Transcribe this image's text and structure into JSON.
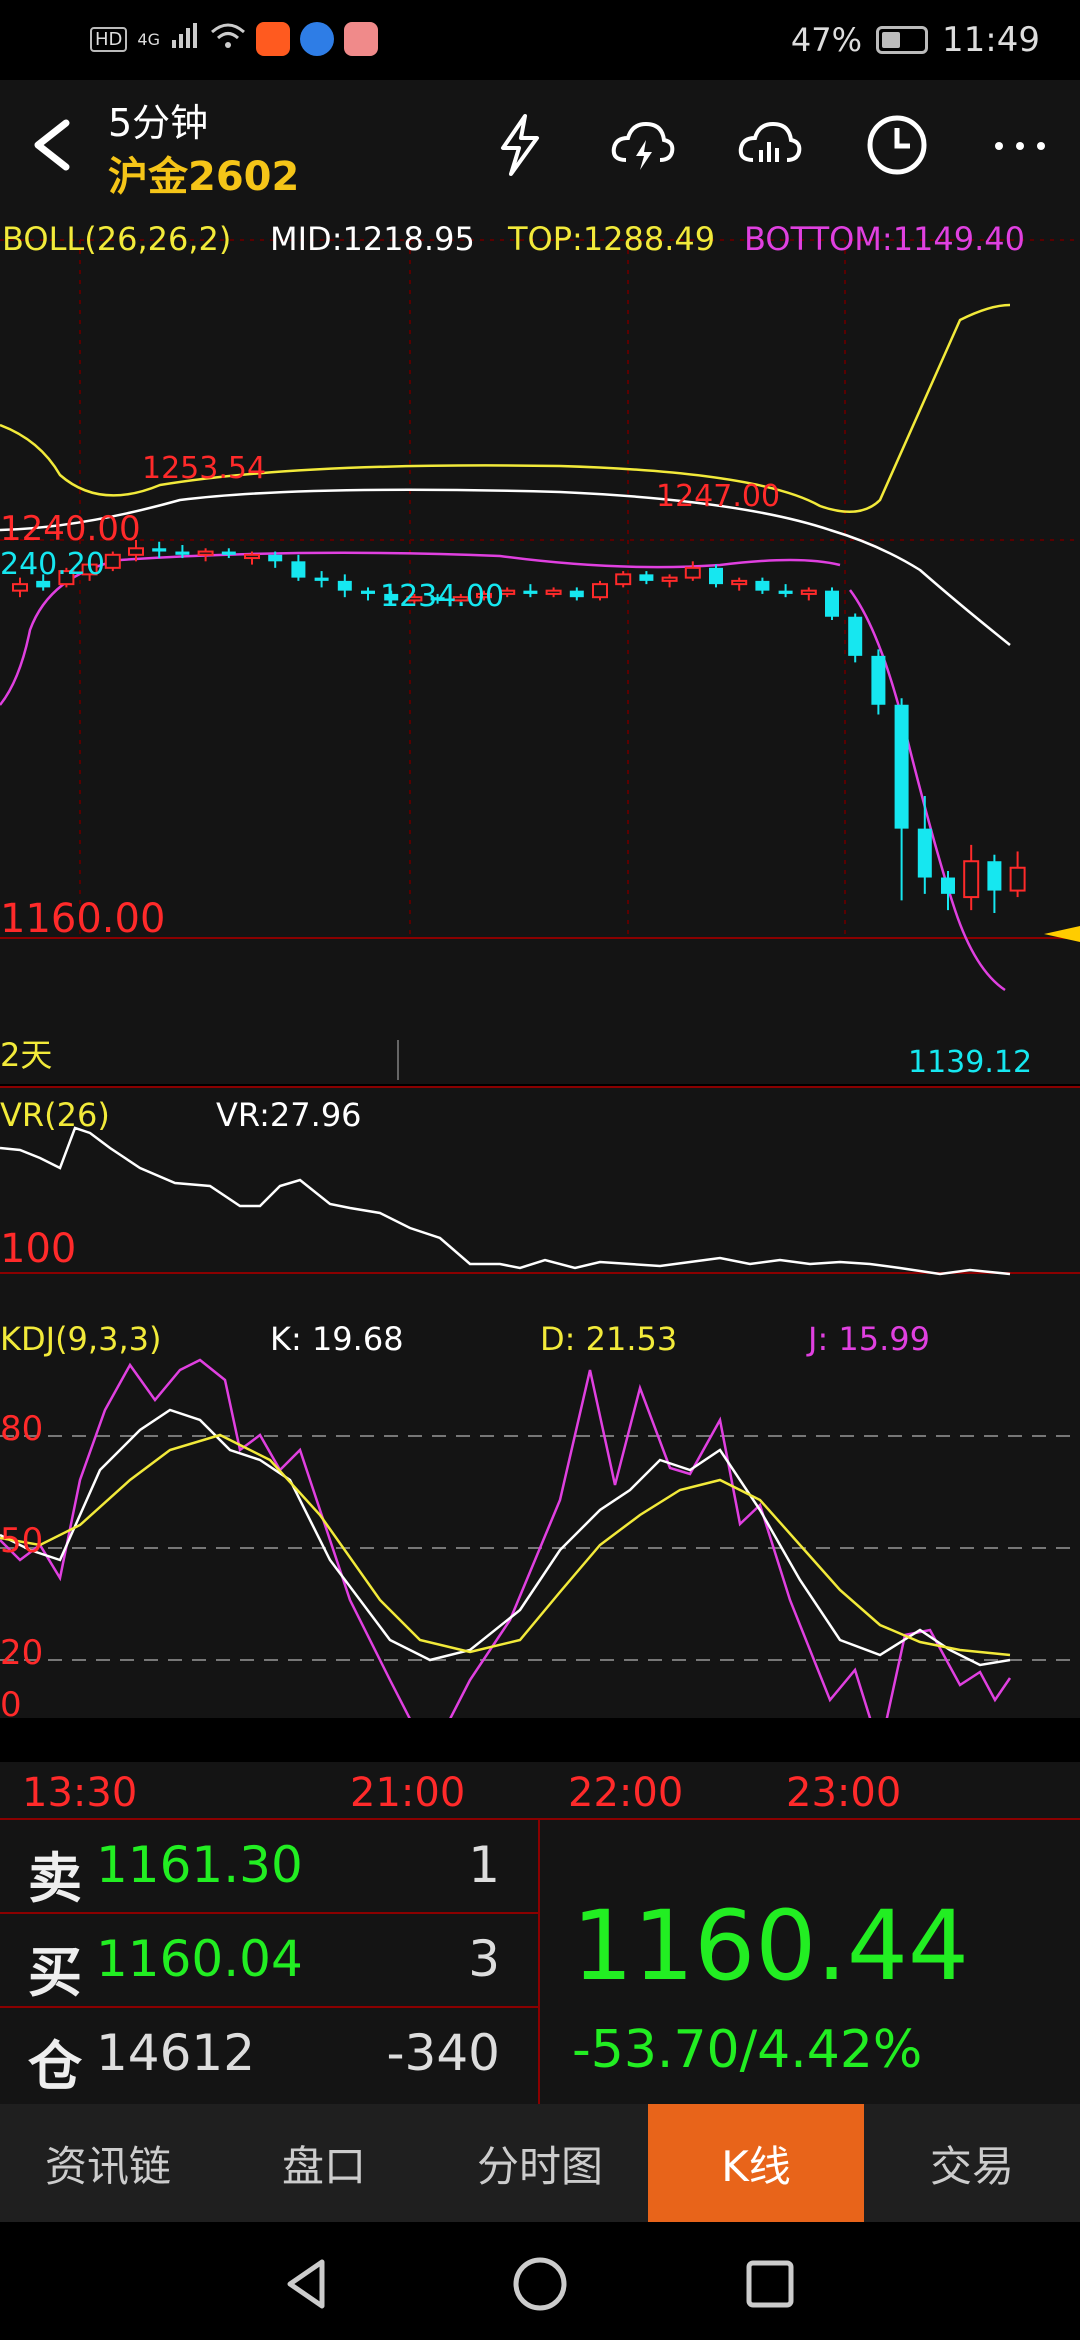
{
  "status_bar": {
    "hd": "HD",
    "network": "4G",
    "battery": "47%",
    "time": "11:49"
  },
  "header": {
    "period": "5分钟",
    "contract": "沪金2602"
  },
  "boll": {
    "title": "BOLL(26,26,2)",
    "mid": "MID:1218.95",
    "top": "TOP:1288.49",
    "bottom": "BOTTOM:1149.40",
    "label_high1": "1253.54",
    "label_high2": "1247.00",
    "label_low1": "1234.00",
    "label_low2": "1139.12",
    "label_left_cyan": "240.20",
    "label_left_red": "1240.00",
    "price_level": "1160.00",
    "days": "2天"
  },
  "vr": {
    "title": "VR(26)",
    "value": "VR:27.96",
    "level": "100"
  },
  "kdj": {
    "title": "KDJ(9,3,3)",
    "k": "K: 19.68",
    "d": "D: 21.53",
    "j": "J: 15.99",
    "levels": [
      "80",
      "50",
      "20",
      "0"
    ]
  },
  "time_axis": [
    "13:30",
    "21:00",
    "22:00",
    "23:00"
  ],
  "order_book": {
    "sell_key": "卖",
    "sell_price": "1161.30",
    "sell_qty": "1",
    "buy_key": "买",
    "buy_price": "1160.04",
    "buy_qty": "3",
    "oi_key": "仓",
    "open_interest": "14612",
    "oi_change": "-340",
    "last_price": "1160.44",
    "change": "-53.70/4.42%"
  },
  "tabs": [
    "资讯链",
    "盘口",
    "分时图",
    "K线",
    "交易"
  ],
  "active_tab": "K线",
  "colors": {
    "up": "#ff2a2a",
    "down": "#16e7f0",
    "mid": "#ffffff",
    "top": "#f2ea3a",
    "bottom": "#e040e0",
    "green": "#22ee22",
    "accent": "#e8641a"
  },
  "chart_data": {
    "type": "candlestick",
    "candles": [
      {
        "o": 1238,
        "h": 1242,
        "l": 1236,
        "c": 1240,
        "dir": "up"
      },
      {
        "o": 1241,
        "h": 1243,
        "l": 1238,
        "c": 1239,
        "dir": "down"
      },
      {
        "o": 1240,
        "h": 1245,
        "l": 1239,
        "c": 1244,
        "dir": "up"
      },
      {
        "o": 1243,
        "h": 1247,
        "l": 1241,
        "c": 1246,
        "dir": "up"
      },
      {
        "o": 1245,
        "h": 1250,
        "l": 1244,
        "c": 1249,
        "dir": "up"
      },
      {
        "o": 1249,
        "h": 1253.54,
        "l": 1247,
        "c": 1251,
        "dir": "up"
      },
      {
        "o": 1251,
        "h": 1253,
        "l": 1248,
        "c": 1250,
        "dir": "down"
      },
      {
        "o": 1250,
        "h": 1252,
        "l": 1248,
        "c": 1249,
        "dir": "down"
      },
      {
        "o": 1249,
        "h": 1251,
        "l": 1247,
        "c": 1250,
        "dir": "up"
      },
      {
        "o": 1250,
        "h": 1251,
        "l": 1248,
        "c": 1249,
        "dir": "down"
      },
      {
        "o": 1248,
        "h": 1250,
        "l": 1246,
        "c": 1249,
        "dir": "up"
      },
      {
        "o": 1249,
        "h": 1250,
        "l": 1245,
        "c": 1247,
        "dir": "down"
      },
      {
        "o": 1247,
        "h": 1249,
        "l": 1241,
        "c": 1242,
        "dir": "down"
      },
      {
        "o": 1242,
        "h": 1244,
        "l": 1239,
        "c": 1241,
        "dir": "down"
      },
      {
        "o": 1241,
        "h": 1243,
        "l": 1236,
        "c": 1238,
        "dir": "down"
      },
      {
        "o": 1238,
        "h": 1239,
        "l": 1235,
        "c": 1237,
        "dir": "down"
      },
      {
        "o": 1237,
        "h": 1238,
        "l": 1234,
        "c": 1235,
        "dir": "down"
      },
      {
        "o": 1235,
        "h": 1237,
        "l": 1234,
        "c": 1236,
        "dir": "up"
      },
      {
        "o": 1236,
        "h": 1237,
        "l": 1234,
        "c": 1235,
        "dir": "down"
      },
      {
        "o": 1235,
        "h": 1237,
        "l": 1234,
        "c": 1236,
        "dir": "up"
      },
      {
        "o": 1236,
        "h": 1238,
        "l": 1235,
        "c": 1237,
        "dir": "up"
      },
      {
        "o": 1237,
        "h": 1239,
        "l": 1236,
        "c": 1238,
        "dir": "up"
      },
      {
        "o": 1238,
        "h": 1240,
        "l": 1236,
        "c": 1237,
        "dir": "down"
      },
      {
        "o": 1237,
        "h": 1239,
        "l": 1236,
        "c": 1238,
        "dir": "up"
      },
      {
        "o": 1238,
        "h": 1239,
        "l": 1235,
        "c": 1236,
        "dir": "down"
      },
      {
        "o": 1236,
        "h": 1241,
        "l": 1235,
        "c": 1240,
        "dir": "up"
      },
      {
        "o": 1240,
        "h": 1244,
        "l": 1239,
        "c": 1243,
        "dir": "up"
      },
      {
        "o": 1243,
        "h": 1244,
        "l": 1240,
        "c": 1241,
        "dir": "down"
      },
      {
        "o": 1241,
        "h": 1243,
        "l": 1239,
        "c": 1242,
        "dir": "up"
      },
      {
        "o": 1242,
        "h": 1247,
        "l": 1241,
        "c": 1245,
        "dir": "up"
      },
      {
        "o": 1245,
        "h": 1246,
        "l": 1239,
        "c": 1240,
        "dir": "down"
      },
      {
        "o": 1240,
        "h": 1242,
        "l": 1238,
        "c": 1241,
        "dir": "up"
      },
      {
        "o": 1241,
        "h": 1242,
        "l": 1237,
        "c": 1238,
        "dir": "down"
      },
      {
        "o": 1238,
        "h": 1240,
        "l": 1236,
        "c": 1237,
        "dir": "down"
      },
      {
        "o": 1237,
        "h": 1239,
        "l": 1235,
        "c": 1238,
        "dir": "up"
      },
      {
        "o": 1238,
        "h": 1239,
        "l": 1229,
        "c": 1230,
        "dir": "down"
      },
      {
        "o": 1230,
        "h": 1231,
        "l": 1216,
        "c": 1218,
        "dir": "down"
      },
      {
        "o": 1218,
        "h": 1220,
        "l": 1200,
        "c": 1203,
        "dir": "down"
      },
      {
        "o": 1203,
        "h": 1205,
        "l": 1143,
        "c": 1165,
        "dir": "down"
      },
      {
        "o": 1165,
        "h": 1175,
        "l": 1145,
        "c": 1150,
        "dir": "down"
      },
      {
        "o": 1150,
        "h": 1152,
        "l": 1140,
        "c": 1145,
        "dir": "down"
      },
      {
        "o": 1144,
        "h": 1160,
        "l": 1140,
        "c": 1155,
        "dir": "up"
      },
      {
        "o": 1155,
        "h": 1157,
        "l": 1139.12,
        "c": 1146,
        "dir": "down"
      },
      {
        "o": 1146,
        "h": 1158,
        "l": 1144,
        "c": 1153,
        "dir": "up"
      }
    ]
  }
}
